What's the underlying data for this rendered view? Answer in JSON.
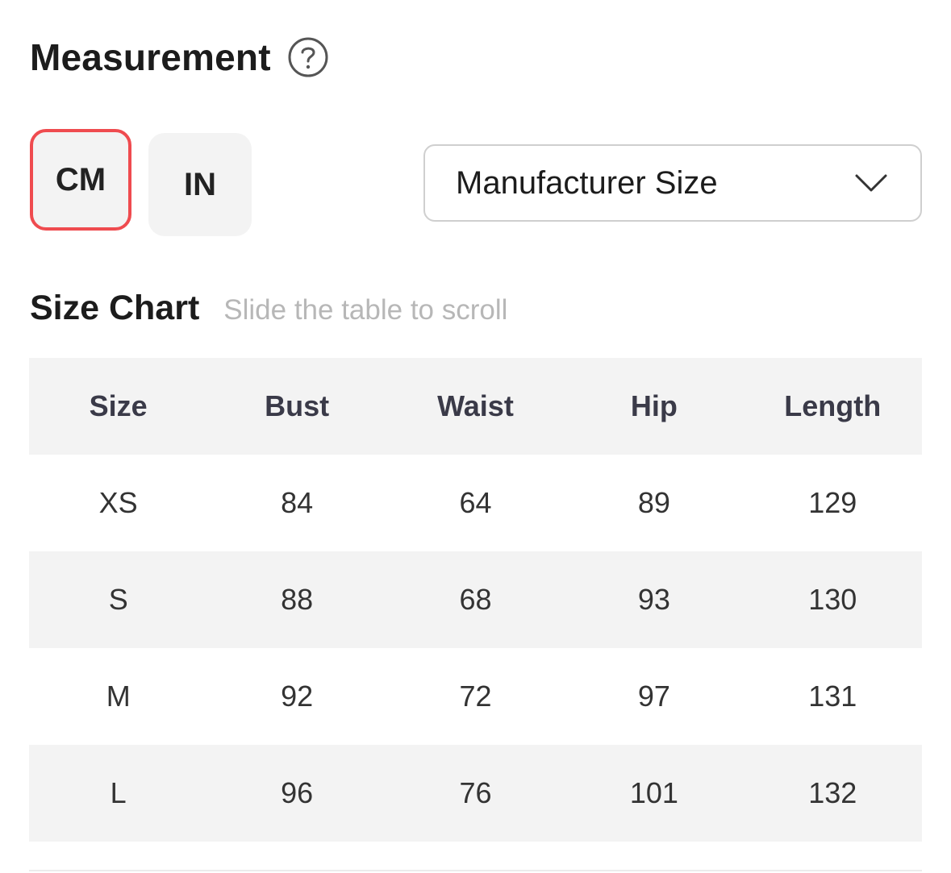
{
  "measurement": {
    "title": "Measurement",
    "help_icon": "question-circle-icon"
  },
  "units": {
    "cm_label": "CM",
    "in_label": "IN",
    "selected": "CM",
    "selected_border_color": "#ef4b4f"
  },
  "size_select": {
    "value": "Manufacturer Size",
    "icon": "chevron-down-icon"
  },
  "size_chart": {
    "title": "Size Chart",
    "hint": "Slide the table to scroll",
    "columns": [
      "Size",
      "Bust",
      "Waist",
      "Hip",
      "Length"
    ],
    "rows": [
      [
        "XS",
        "84",
        "64",
        "89",
        "129"
      ],
      [
        "S",
        "88",
        "68",
        "93",
        "130"
      ],
      [
        "M",
        "92",
        "72",
        "97",
        "131"
      ],
      [
        "L",
        "96",
        "76",
        "101",
        "132"
      ]
    ]
  }
}
